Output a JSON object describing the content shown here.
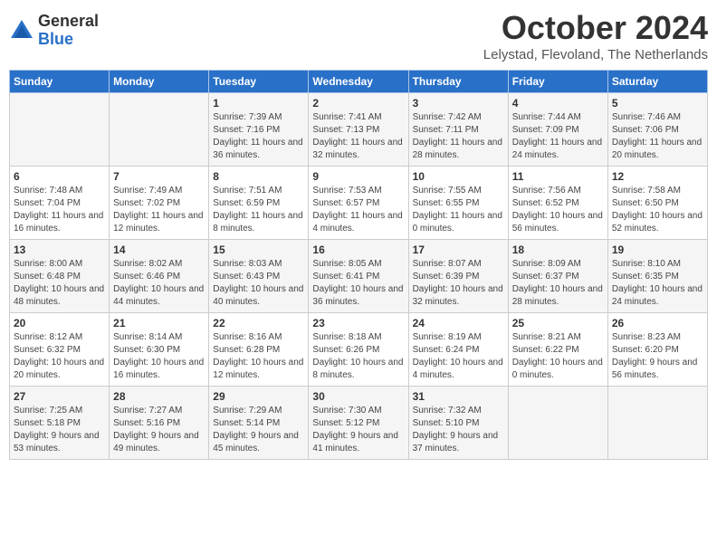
{
  "header": {
    "logo_general": "General",
    "logo_blue": "Blue",
    "title": "October 2024",
    "location": "Lelystad, Flevoland, The Netherlands"
  },
  "days_of_week": [
    "Sunday",
    "Monday",
    "Tuesday",
    "Wednesday",
    "Thursday",
    "Friday",
    "Saturday"
  ],
  "weeks": [
    [
      {
        "day": "",
        "info": ""
      },
      {
        "day": "",
        "info": ""
      },
      {
        "day": "1",
        "info": "Sunrise: 7:39 AM\nSunset: 7:16 PM\nDaylight: 11 hours and 36 minutes."
      },
      {
        "day": "2",
        "info": "Sunrise: 7:41 AM\nSunset: 7:13 PM\nDaylight: 11 hours and 32 minutes."
      },
      {
        "day": "3",
        "info": "Sunrise: 7:42 AM\nSunset: 7:11 PM\nDaylight: 11 hours and 28 minutes."
      },
      {
        "day": "4",
        "info": "Sunrise: 7:44 AM\nSunset: 7:09 PM\nDaylight: 11 hours and 24 minutes."
      },
      {
        "day": "5",
        "info": "Sunrise: 7:46 AM\nSunset: 7:06 PM\nDaylight: 11 hours and 20 minutes."
      }
    ],
    [
      {
        "day": "6",
        "info": "Sunrise: 7:48 AM\nSunset: 7:04 PM\nDaylight: 11 hours and 16 minutes."
      },
      {
        "day": "7",
        "info": "Sunrise: 7:49 AM\nSunset: 7:02 PM\nDaylight: 11 hours and 12 minutes."
      },
      {
        "day": "8",
        "info": "Sunrise: 7:51 AM\nSunset: 6:59 PM\nDaylight: 11 hours and 8 minutes."
      },
      {
        "day": "9",
        "info": "Sunrise: 7:53 AM\nSunset: 6:57 PM\nDaylight: 11 hours and 4 minutes."
      },
      {
        "day": "10",
        "info": "Sunrise: 7:55 AM\nSunset: 6:55 PM\nDaylight: 11 hours and 0 minutes."
      },
      {
        "day": "11",
        "info": "Sunrise: 7:56 AM\nSunset: 6:52 PM\nDaylight: 10 hours and 56 minutes."
      },
      {
        "day": "12",
        "info": "Sunrise: 7:58 AM\nSunset: 6:50 PM\nDaylight: 10 hours and 52 minutes."
      }
    ],
    [
      {
        "day": "13",
        "info": "Sunrise: 8:00 AM\nSunset: 6:48 PM\nDaylight: 10 hours and 48 minutes."
      },
      {
        "day": "14",
        "info": "Sunrise: 8:02 AM\nSunset: 6:46 PM\nDaylight: 10 hours and 44 minutes."
      },
      {
        "day": "15",
        "info": "Sunrise: 8:03 AM\nSunset: 6:43 PM\nDaylight: 10 hours and 40 minutes."
      },
      {
        "day": "16",
        "info": "Sunrise: 8:05 AM\nSunset: 6:41 PM\nDaylight: 10 hours and 36 minutes."
      },
      {
        "day": "17",
        "info": "Sunrise: 8:07 AM\nSunset: 6:39 PM\nDaylight: 10 hours and 32 minutes."
      },
      {
        "day": "18",
        "info": "Sunrise: 8:09 AM\nSunset: 6:37 PM\nDaylight: 10 hours and 28 minutes."
      },
      {
        "day": "19",
        "info": "Sunrise: 8:10 AM\nSunset: 6:35 PM\nDaylight: 10 hours and 24 minutes."
      }
    ],
    [
      {
        "day": "20",
        "info": "Sunrise: 8:12 AM\nSunset: 6:32 PM\nDaylight: 10 hours and 20 minutes."
      },
      {
        "day": "21",
        "info": "Sunrise: 8:14 AM\nSunset: 6:30 PM\nDaylight: 10 hours and 16 minutes."
      },
      {
        "day": "22",
        "info": "Sunrise: 8:16 AM\nSunset: 6:28 PM\nDaylight: 10 hours and 12 minutes."
      },
      {
        "day": "23",
        "info": "Sunrise: 8:18 AM\nSunset: 6:26 PM\nDaylight: 10 hours and 8 minutes."
      },
      {
        "day": "24",
        "info": "Sunrise: 8:19 AM\nSunset: 6:24 PM\nDaylight: 10 hours and 4 minutes."
      },
      {
        "day": "25",
        "info": "Sunrise: 8:21 AM\nSunset: 6:22 PM\nDaylight: 10 hours and 0 minutes."
      },
      {
        "day": "26",
        "info": "Sunrise: 8:23 AM\nSunset: 6:20 PM\nDaylight: 9 hours and 56 minutes."
      }
    ],
    [
      {
        "day": "27",
        "info": "Sunrise: 7:25 AM\nSunset: 5:18 PM\nDaylight: 9 hours and 53 minutes."
      },
      {
        "day": "28",
        "info": "Sunrise: 7:27 AM\nSunset: 5:16 PM\nDaylight: 9 hours and 49 minutes."
      },
      {
        "day": "29",
        "info": "Sunrise: 7:29 AM\nSunset: 5:14 PM\nDaylight: 9 hours and 45 minutes."
      },
      {
        "day": "30",
        "info": "Sunrise: 7:30 AM\nSunset: 5:12 PM\nDaylight: 9 hours and 41 minutes."
      },
      {
        "day": "31",
        "info": "Sunrise: 7:32 AM\nSunset: 5:10 PM\nDaylight: 9 hours and 37 minutes."
      },
      {
        "day": "",
        "info": ""
      },
      {
        "day": "",
        "info": ""
      }
    ]
  ]
}
